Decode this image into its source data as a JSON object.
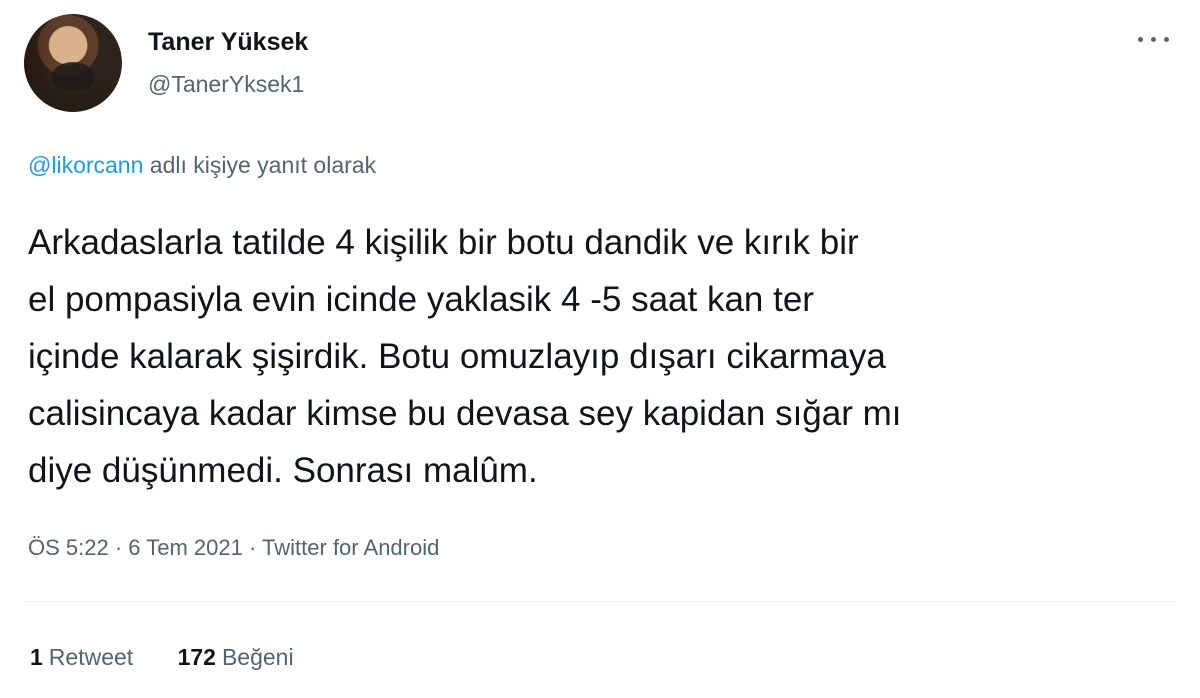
{
  "tweet": {
    "author": {
      "name": "Taner Yüksek",
      "handle": "@TanerYksek1"
    },
    "reply": {
      "mention": "@likorcann",
      "suffix": "adlı kişiye yanıt olarak"
    },
    "text_lines": [
      "Arkadaslarla tatilde 4 kişilik bir botu dandik ve kırık bir",
      "el pompasiyla evin icinde yaklasik 4 -5 saat kan ter",
      "içinde kalarak şişirdik. Botu omuzlayıp dışarı cikarmaya",
      "calisincaya kadar kimse bu devasa sey kapidan sığar mı",
      "diye düşünmedi. Sonrası malûm."
    ],
    "meta": {
      "time": "ÖS 5:22",
      "separator_1": "·",
      "date": "6 Tem 2021",
      "separator_2": "·",
      "source": "Twitter for Android"
    },
    "stats": {
      "retweets_count": "1",
      "retweets_label": "Retweet",
      "likes_count": "172",
      "likes_label": "Beğeni"
    }
  },
  "icons": {
    "more": "more-horizontal-icon"
  },
  "colors": {
    "primary_text": "#0f1419",
    "secondary_text": "#536471",
    "link": "#1d9bf0",
    "divider": "#eff3f4",
    "background": "#ffffff"
  }
}
